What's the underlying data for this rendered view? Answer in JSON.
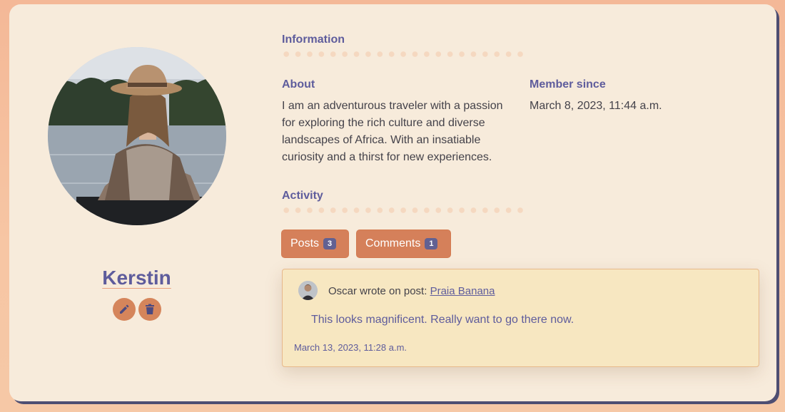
{
  "profile": {
    "username": "Kerstin",
    "edit_icon": "pencil-icon",
    "delete_icon": "trash-icon"
  },
  "information": {
    "title": "Information",
    "about_label": "About",
    "about_text": "I am an adventurous traveler with a passion for exploring the rich culture and diverse landscapes of Africa. With an insatiable curiosity and a thirst for new experiences.",
    "member_since_label": "Member since",
    "member_since_value": "March 8, 2023, 11:44 a.m."
  },
  "activity": {
    "title": "Activity",
    "tabs": [
      {
        "label": "Posts",
        "count": "3"
      },
      {
        "label": "Comments",
        "count": "1"
      }
    ],
    "comment": {
      "author_text": "Oscar wrote on post:",
      "post_link": "Praia Banana",
      "body": "This looks magnificent. Really want to go there now.",
      "date": "March 13, 2023, 11:28 a.m."
    }
  },
  "colors": {
    "accent": "#5e5c9c",
    "button": "#d5805a",
    "badge": "#626192",
    "card_bg": "#f7ebdb",
    "comment_bg": "#f7e7c1"
  }
}
